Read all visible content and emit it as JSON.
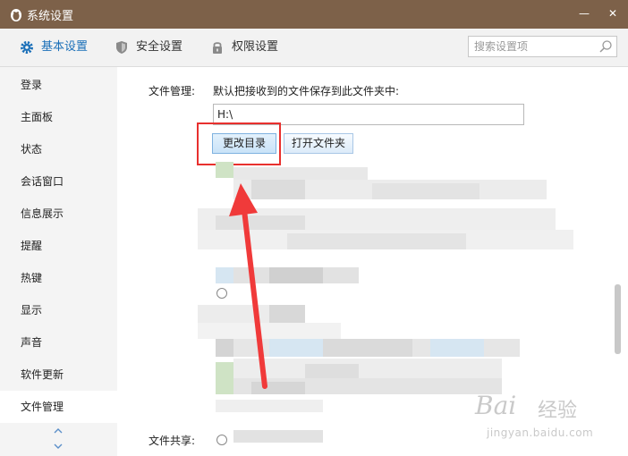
{
  "window": {
    "title": "系统设置",
    "minimize_glyph": "—",
    "close_glyph": "✕",
    "icon": "penguin-icon"
  },
  "tabs": [
    {
      "label": "基本设置",
      "icon": "gear-icon",
      "active": true
    },
    {
      "label": "安全设置",
      "icon": "shield-icon",
      "active": false
    },
    {
      "label": "权限设置",
      "icon": "lock-icon",
      "active": false
    }
  ],
  "search": {
    "placeholder": "搜索设置项",
    "value": "",
    "icon": "search-icon"
  },
  "sidebar": {
    "items": [
      {
        "label": "登录"
      },
      {
        "label": "主面板"
      },
      {
        "label": "状态"
      },
      {
        "label": "会话窗口"
      },
      {
        "label": "信息展示"
      },
      {
        "label": "提醒"
      },
      {
        "label": "热键"
      },
      {
        "label": "显示"
      },
      {
        "label": "声音"
      },
      {
        "label": "软件更新"
      },
      {
        "label": "文件管理",
        "active": true
      }
    ]
  },
  "file_management": {
    "label": "文件管理:",
    "description": "默认把接收到的文件保存到此文件夹中:",
    "path": "H:\\",
    "change_button": "更改目录",
    "open_button": "打开文件夹"
  },
  "file_sharing": {
    "label": "文件共享:"
  },
  "watermark": {
    "brand": "Bai",
    "brand2": "经验",
    "url": "jingyan.baidu.com"
  },
  "colors": {
    "titlebar": "#7d6149",
    "accent": "#1a6fb8",
    "highlight": "#e8302e",
    "arrow": "#f03a3a"
  }
}
